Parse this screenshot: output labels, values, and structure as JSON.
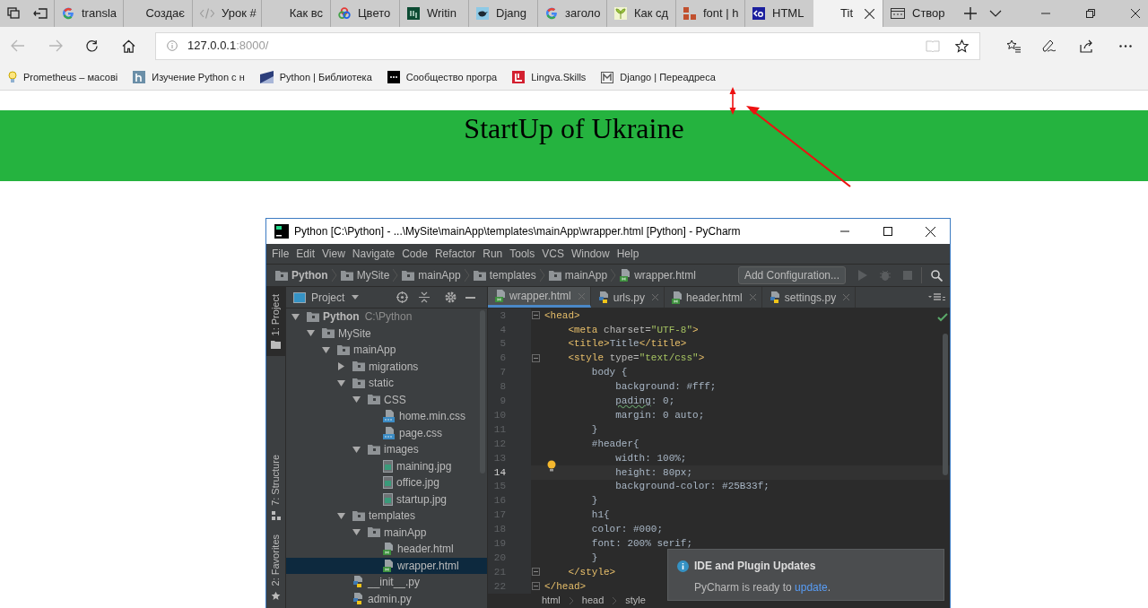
{
  "browser": {
    "tabs": [
      {
        "label": "transla",
        "selected": false
      },
      {
        "label": "Создає",
        "selected": false
      },
      {
        "label": "Урок #",
        "selected": false
      },
      {
        "label": "Как вс",
        "selected": false
      },
      {
        "label": "Цвето",
        "selected": false
      },
      {
        "label": "Writin",
        "selected": false
      },
      {
        "label": "Djang",
        "selected": false
      },
      {
        "label": "заголо",
        "selected": false
      },
      {
        "label": "Как сд",
        "selected": false
      },
      {
        "label": "font | h",
        "selected": false
      },
      {
        "label": "HTML",
        "selected": false
      },
      {
        "label": "Tit",
        "selected": true
      },
      {
        "label": "Створ",
        "selected": false
      }
    ],
    "address": {
      "host": "127.0.0.1",
      "port": ":8000/"
    },
    "bookmarks": [
      "Prometheus – масові",
      "Изучение Python с н",
      "Python | Библиотека",
      "Сообщество програ",
      "Lingva.Skills",
      "Django | Переадреса"
    ]
  },
  "page": {
    "header_title": "StartUp of Ukraine"
  },
  "ide": {
    "title": "Python [C:\\Python] - ...\\MySite\\mainApp\\templates\\mainApp\\wrapper.html [Python] - PyCharm",
    "menu": [
      "File",
      "Edit",
      "View",
      "Navigate",
      "Code",
      "Refactor",
      "Run",
      "Tools",
      "VCS",
      "Window",
      "Help"
    ],
    "breadcrumbs": [
      {
        "label": "Python",
        "kind": "folder"
      },
      {
        "label": "MySite",
        "kind": "folder"
      },
      {
        "label": "mainApp",
        "kind": "folder"
      },
      {
        "label": "templates",
        "kind": "folder"
      },
      {
        "label": "mainApp",
        "kind": "folder"
      },
      {
        "label": "wrapper.html",
        "kind": "html"
      }
    ],
    "run_config": "Add Configuration...",
    "side_tabs": [
      {
        "label": "1: Project",
        "selected": true
      },
      {
        "label": "7: Structure",
        "selected": false
      },
      {
        "label": "2: Favorites",
        "selected": false
      }
    ],
    "project_panel": {
      "title": "Project",
      "tree": [
        {
          "label": "Python",
          "hint": "C:\\Python",
          "kind": "folder",
          "expanded": true,
          "selected": false,
          "children": [
            {
              "label": "MySite",
              "kind": "folder",
              "expanded": true,
              "selected": false,
              "children": [
                {
                  "label": "mainApp",
                  "kind": "folder",
                  "expanded": true,
                  "selected": false,
                  "children": [
                    {
                      "label": "migrations",
                      "kind": "folder",
                      "expanded": false,
                      "selected": false
                    },
                    {
                      "label": "static",
                      "kind": "folder",
                      "expanded": true,
                      "selected": false,
                      "children": [
                        {
                          "label": "CSS",
                          "kind": "folder",
                          "expanded": true,
                          "selected": false,
                          "children": [
                            {
                              "label": "home.min.css",
                              "kind": "css",
                              "selected": false
                            },
                            {
                              "label": "page.css",
                              "kind": "css",
                              "selected": false
                            }
                          ]
                        },
                        {
                          "label": "images",
                          "kind": "folder",
                          "expanded": true,
                          "selected": false,
                          "children": [
                            {
                              "label": "maining.jpg",
                              "kind": "image",
                              "selected": false
                            },
                            {
                              "label": "office.jpg",
                              "kind": "image",
                              "selected": false
                            },
                            {
                              "label": "startup.jpg",
                              "kind": "image",
                              "selected": false
                            }
                          ]
                        }
                      ]
                    },
                    {
                      "label": "templates",
                      "kind": "folder",
                      "expanded": true,
                      "selected": false,
                      "children": [
                        {
                          "label": "mainApp",
                          "kind": "folder",
                          "expanded": true,
                          "selected": false,
                          "children": [
                            {
                              "label": "header.html",
                              "kind": "html",
                              "selected": false
                            },
                            {
                              "label": "wrapper.html",
                              "kind": "html",
                              "selected": true
                            }
                          ]
                        }
                      ]
                    },
                    {
                      "label": "__init__.py",
                      "kind": "python",
                      "selected": false
                    },
                    {
                      "label": "admin.py",
                      "kind": "python",
                      "selected": false
                    }
                  ]
                }
              ]
            }
          ]
        }
      ]
    },
    "editor_tabs": [
      {
        "label": "wrapper.html",
        "kind": "html",
        "selected": true
      },
      {
        "label": "urls.py",
        "kind": "python",
        "selected": false
      },
      {
        "label": "header.html",
        "kind": "html",
        "selected": false
      },
      {
        "label": "settings.py",
        "kind": "python",
        "selected": false
      }
    ],
    "code_lines": [
      {
        "number": "3",
        "fold": true,
        "current": false,
        "segments": [
          {
            "kind": "tag",
            "text": "<head>"
          }
        ]
      },
      {
        "number": "4",
        "fold": false,
        "current": false,
        "segments": [
          {
            "kind": "tag",
            "text": "    <meta"
          },
          {
            "kind": "attr",
            "text": " charset="
          },
          {
            "kind": "string",
            "text": "\"UTF-8\""
          },
          {
            "kind": "tag",
            "text": ">"
          }
        ]
      },
      {
        "number": "5",
        "fold": false,
        "current": false,
        "segments": [
          {
            "kind": "tag",
            "text": "    <title>"
          },
          {
            "kind": "text",
            "text": "Title"
          },
          {
            "kind": "tag",
            "text": "</title>"
          }
        ]
      },
      {
        "number": "6",
        "fold": true,
        "current": false,
        "segments": [
          {
            "kind": "tag",
            "text": "    <style"
          },
          {
            "kind": "attr",
            "text": " type="
          },
          {
            "kind": "string",
            "text": "\"text/css\""
          },
          {
            "kind": "tag",
            "text": ">"
          }
        ]
      },
      {
        "number": "7",
        "fold": false,
        "current": false,
        "segments": [
          {
            "kind": "text",
            "text": "        body {"
          }
        ]
      },
      {
        "number": "8",
        "fold": false,
        "current": false,
        "segments": [
          {
            "kind": "text",
            "text": "            background: #fff;"
          }
        ]
      },
      {
        "number": "9",
        "fold": false,
        "current": false,
        "segments": [
          {
            "kind": "typo",
            "text": "            pading"
          },
          {
            "kind": "text",
            "text": ": 0;"
          }
        ]
      },
      {
        "number": "10",
        "fold": false,
        "current": false,
        "segments": [
          {
            "kind": "text",
            "text": "            margin: 0 auto;"
          }
        ]
      },
      {
        "number": "11",
        "fold": false,
        "current": false,
        "segments": [
          {
            "kind": "text",
            "text": "        }"
          }
        ]
      },
      {
        "number": "12",
        "fold": false,
        "current": false,
        "segments": [
          {
            "kind": "text",
            "text": "        #header{"
          }
        ]
      },
      {
        "number": "13",
        "fold": false,
        "current": false,
        "segments": [
          {
            "kind": "text",
            "text": "            width: 100%;"
          }
        ]
      },
      {
        "number": "14",
        "fold": false,
        "current": true,
        "segments": [
          {
            "kind": "text",
            "text": "            height: 80px;"
          }
        ]
      },
      {
        "number": "15",
        "fold": false,
        "current": false,
        "segments": [
          {
            "kind": "text",
            "text": "            background-color: #25B33f;"
          }
        ]
      },
      {
        "number": "16",
        "fold": false,
        "current": false,
        "segments": [
          {
            "kind": "text",
            "text": "        }"
          }
        ]
      },
      {
        "number": "17",
        "fold": false,
        "current": false,
        "segments": [
          {
            "kind": "text",
            "text": "        h1{"
          }
        ]
      },
      {
        "number": "18",
        "fold": false,
        "current": false,
        "segments": [
          {
            "kind": "text",
            "text": "        color: #000;"
          }
        ]
      },
      {
        "number": "19",
        "fold": false,
        "current": false,
        "segments": [
          {
            "kind": "text",
            "text": "        font: 200% serif;"
          }
        ]
      },
      {
        "number": "20",
        "fold": false,
        "current": false,
        "segments": [
          {
            "kind": "text",
            "text": "        }"
          }
        ]
      },
      {
        "number": "21",
        "fold": true,
        "current": false,
        "segments": [
          {
            "kind": "tag",
            "text": "    </style>"
          }
        ]
      },
      {
        "number": "22",
        "fold": true,
        "current": false,
        "segments": [
          {
            "kind": "tag",
            "text": "</head>"
          }
        ]
      }
    ],
    "path_bar": [
      "html",
      "head",
      "style"
    ],
    "notification": {
      "title": "IDE and Plugin Updates",
      "text": "PyCharm is ready to ",
      "link": "update",
      "end": "."
    }
  }
}
